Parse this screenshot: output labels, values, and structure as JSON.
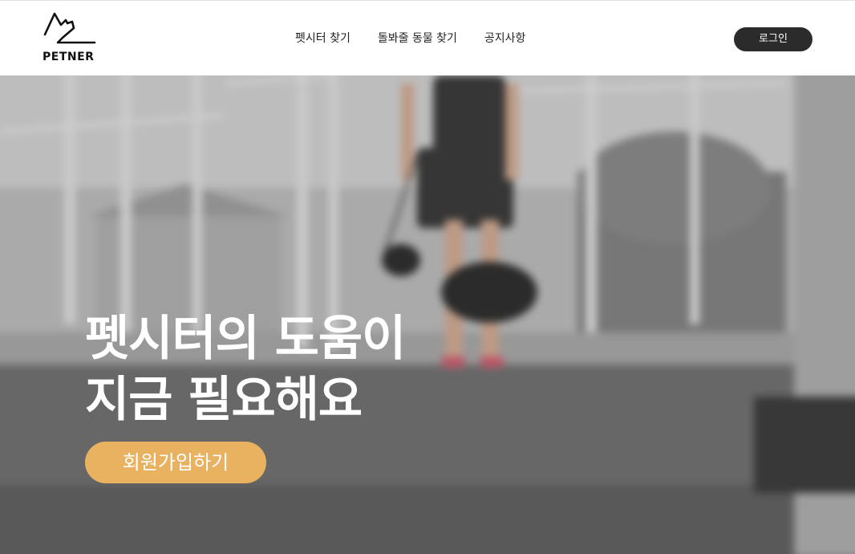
{
  "brand": {
    "logo_icon": "dog-outline-icon",
    "name": "PETNER"
  },
  "nav": {
    "items": [
      {
        "label": "펫시터 찾기"
      },
      {
        "label": "돌봐줄 동물 찾기"
      },
      {
        "label": "공지사항"
      }
    ]
  },
  "header": {
    "login_label": "로그인"
  },
  "hero": {
    "title_line1": "펫시터의 도움이",
    "title_line2": "지금 필요해요",
    "signup_label": "회원가입하기",
    "background_image": "blurred-photo-person-walking-dog"
  },
  "colors": {
    "accent": "#e9b261",
    "login_button": "#2b2b2b",
    "text_dark": "#222222"
  }
}
